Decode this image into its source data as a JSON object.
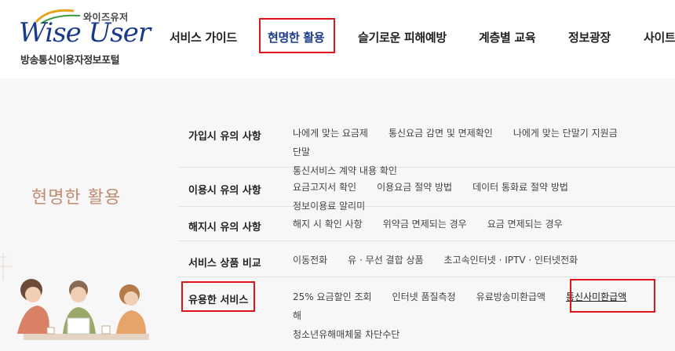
{
  "logo": {
    "small": "와이즈유저",
    "main": "Wise User",
    "sub": "방송통신이용자정보포털"
  },
  "gnb": {
    "items": [
      {
        "label": "서비스 가이드"
      },
      {
        "label": "현명한 활용"
      },
      {
        "label": "슬기로운 피해예방"
      },
      {
        "label": "계층별 교육"
      },
      {
        "label": "정보광장"
      },
      {
        "label": "사이트"
      }
    ]
  },
  "section": {
    "title": "현명한 활용"
  },
  "menu": {
    "rows": [
      {
        "title": "가입시 유의 사항",
        "links": [
          "나에게 맞는 요금제",
          "통신요금 감면 및 면제확인",
          "나에게 맞는 단말기 지원금",
          "단말",
          "통신서비스 계약 내용 확인"
        ]
      },
      {
        "title": "이용시 유의 사항",
        "links": [
          "요금고지서 확인",
          "이용요금 절약 방법",
          "데이터 통화료 절약 방법",
          "정보이용료 알리미"
        ]
      },
      {
        "title": "해지시 유의 사항",
        "links": [
          "해지 시 확인 사항",
          "위약금 면제되는 경우",
          "요금 면제되는 경우"
        ]
      },
      {
        "title": "서비스 상품 비교",
        "links": [
          "이동전화",
          "유 · 무선 결합 상품",
          "초고속인터넷 · IPTV · 인터넷전화"
        ]
      },
      {
        "title": "유용한 서비스",
        "links": [
          "25% 요금할인 조회",
          "인터넷 품질측정",
          "유료방송미환급액",
          "통신사미환급액",
          "해",
          "청소년유해매체물 차단수단"
        ]
      }
    ]
  },
  "colors": {
    "brand": "#1a3a8a",
    "section_title": "#c08b73",
    "highlight": "#e0151a",
    "content_bg": "#f7f7f7"
  }
}
